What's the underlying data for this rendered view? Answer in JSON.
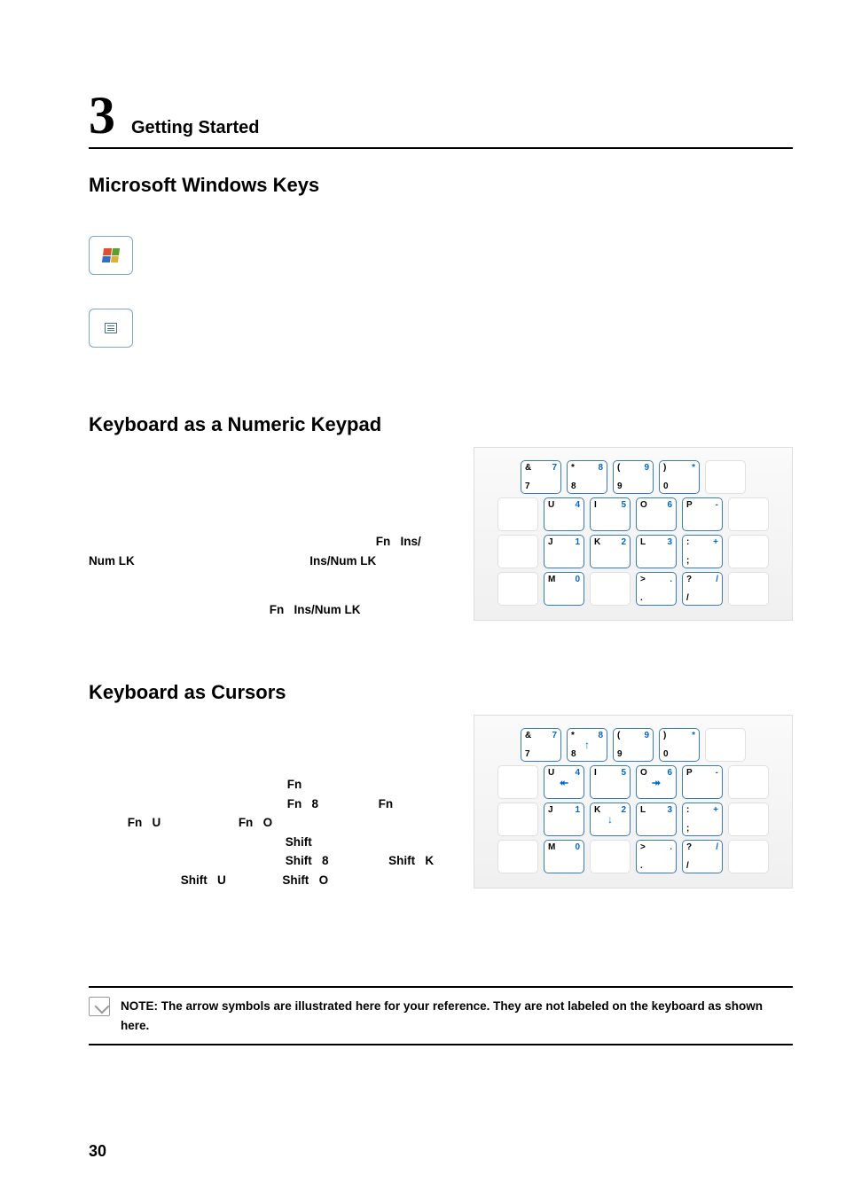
{
  "chapter": {
    "number": "3",
    "title": "Getting Started"
  },
  "sections": {
    "winkeys": {
      "heading": "Microsoft Windows Keys",
      "key1": {
        "name": "windows-logo-key",
        "desc": ""
      },
      "key2": {
        "name": "menu-key",
        "desc": ""
      }
    },
    "numkeypad": {
      "heading": "Keyboard as a Numeric Keypad",
      "paragraph_tokens": [
        "Fn",
        "Ins/",
        "Num LK",
        "Ins/Num LK",
        "Fn",
        "Ins/Num LK"
      ],
      "diagram": {
        "rows": [
          [
            {
              "tl": "&",
              "tr": "7",
              "bl": "7"
            },
            {
              "tl": "*",
              "tr": "8",
              "bl": "8"
            },
            {
              "tl": "(",
              "tr": "9",
              "bl": "9"
            },
            {
              "tl": ")",
              "tr": "*",
              "bl": "0"
            },
            {
              "ghost": true
            }
          ],
          [
            {
              "ghost": true
            },
            {
              "tl": "U",
              "tr": "4"
            },
            {
              "tl": "I",
              "tr": "5"
            },
            {
              "tl": "O",
              "tr": "6"
            },
            {
              "tl": "P",
              "tr": "-"
            },
            {
              "ghost": true
            }
          ],
          [
            {
              "ghost": true
            },
            {
              "tl": "J",
              "tr": "1"
            },
            {
              "tl": "K",
              "tr": "2"
            },
            {
              "tl": "L",
              "tr": "3"
            },
            {
              "tl": ":",
              "tr": "+",
              "bl": ";"
            },
            {
              "ghost": true
            }
          ],
          [
            {
              "ghost": true
            },
            {
              "tl": "M",
              "tr": "0"
            },
            {
              "ghost": true
            },
            {
              "tl": ">",
              "tr": ".",
              "bl": "."
            },
            {
              "tl": "?",
              "tr": "/",
              "bl": "/"
            },
            {
              "ghost": true
            }
          ]
        ]
      }
    },
    "cursors": {
      "heading": "Keyboard as Cursors",
      "tokens_line1": [
        "Fn"
      ],
      "tokens_line2": [
        "Fn",
        "8",
        "Fn"
      ],
      "tokens_line3": [
        "Fn",
        "U",
        "Fn",
        "O"
      ],
      "tokens_line4": [
        "Shift"
      ],
      "tokens_line5": [
        "Shift",
        "8",
        "Shift",
        "K"
      ],
      "tokens_line6": [
        "Shift",
        "U",
        "Shift",
        "O"
      ],
      "diagram": {
        "rows": [
          [
            {
              "tl": "&",
              "tr": "7",
              "bl": "7"
            },
            {
              "tl": "*",
              "tr": "8",
              "bl": "8",
              "arrow": "↑"
            },
            {
              "tl": "(",
              "tr": "9",
              "bl": "9"
            },
            {
              "tl": ")",
              "tr": "*",
              "bl": "0"
            },
            {
              "ghost": true
            }
          ],
          [
            {
              "ghost": true
            },
            {
              "tl": "U",
              "tr": "4",
              "arrow": "⯬"
            },
            {
              "tl": "I",
              "tr": "5"
            },
            {
              "tl": "O",
              "tr": "6",
              "arrow": "⯮"
            },
            {
              "tl": "P",
              "tr": "-"
            },
            {
              "ghost": true
            }
          ],
          [
            {
              "ghost": true
            },
            {
              "tl": "J",
              "tr": "1"
            },
            {
              "tl": "K",
              "tr": "2",
              "arrow": "↓"
            },
            {
              "tl": "L",
              "tr": "3"
            },
            {
              "tl": ":",
              "tr": "+",
              "bl": ";"
            },
            {
              "ghost": true
            }
          ],
          [
            {
              "ghost": true
            },
            {
              "tl": "M",
              "tr": "0"
            },
            {
              "ghost": true
            },
            {
              "tl": ">",
              "tr": ".",
              "bl": "."
            },
            {
              "tl": "?",
              "tr": "/",
              "bl": "/"
            },
            {
              "ghost": true
            }
          ]
        ]
      }
    }
  },
  "note": "NOTE: The arrow symbols are illustrated here for your reference. They are not labeled on the keyboard as shown here.",
  "page_number": "30"
}
